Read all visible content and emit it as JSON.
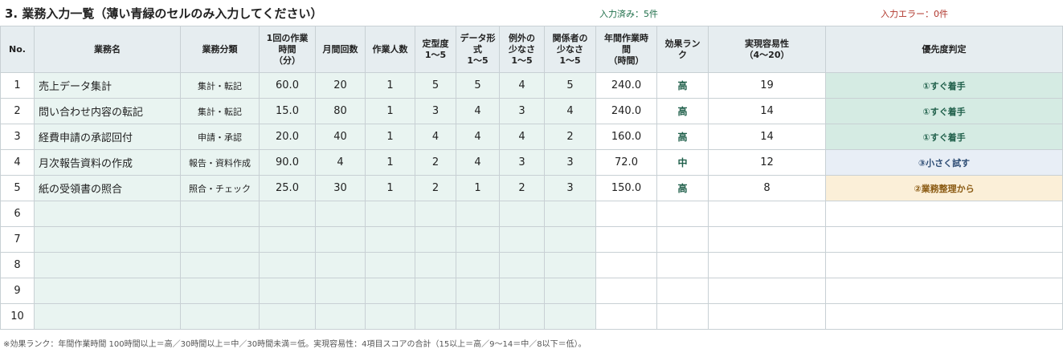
{
  "title": "3. 業務入力一覧（薄い青緑のセルのみ入力してください）",
  "status": {
    "ok": "入力済み：5件",
    "error": "入力エラー：0件"
  },
  "headers": [
    [
      "No."
    ],
    [
      "業務名"
    ],
    [
      "業務分類"
    ],
    [
      "1回の作業",
      "時間",
      "（分）"
    ],
    [
      "月間回数"
    ],
    [
      "作業人数"
    ],
    [
      "定型度",
      "1～5"
    ],
    [
      "データ形",
      "式",
      "1～5"
    ],
    [
      "例外の",
      "少なさ",
      "1～5"
    ],
    [
      "関係者の",
      "少なさ",
      "1～5"
    ],
    [
      "年間作業時",
      "間",
      "（時間）"
    ],
    [
      "効果ラン",
      "ク"
    ],
    [
      "実現容易性",
      "（4～20）"
    ],
    [
      "優先度判定"
    ]
  ],
  "rows": [
    {
      "no": "1",
      "name": "売上データ集計",
      "category": "集計・転記",
      "minutes": "60.0",
      "monthly": "20",
      "people": "1",
      "routine": "5",
      "data_format": "5",
      "exceptions": "4",
      "stakeholders": "5",
      "annual_hours": "240.0",
      "rank": "高",
      "feasibility": "19",
      "priority": "①すぐ着手",
      "priority_color": "green"
    },
    {
      "no": "2",
      "name": "問い合わせ内容の転記",
      "category": "集計・転記",
      "minutes": "15.0",
      "monthly": "80",
      "people": "1",
      "routine": "3",
      "data_format": "4",
      "exceptions": "3",
      "stakeholders": "4",
      "annual_hours": "240.0",
      "rank": "高",
      "feasibility": "14",
      "priority": "①すぐ着手",
      "priority_color": "green"
    },
    {
      "no": "3",
      "name": "経費申請の承認回付",
      "category": "申請・承認",
      "minutes": "20.0",
      "monthly": "40",
      "people": "1",
      "routine": "4",
      "data_format": "4",
      "exceptions": "4",
      "stakeholders": "2",
      "annual_hours": "160.0",
      "rank": "高",
      "feasibility": "14",
      "priority": "①すぐ着手",
      "priority_color": "green"
    },
    {
      "no": "4",
      "name": "月次報告資料の作成",
      "category": "報告・資料作成",
      "minutes": "90.0",
      "monthly": "4",
      "people": "1",
      "routine": "2",
      "data_format": "4",
      "exceptions": "3",
      "stakeholders": "3",
      "annual_hours": "72.0",
      "rank": "中",
      "feasibility": "12",
      "priority": "③小さく試す",
      "priority_color": "blue"
    },
    {
      "no": "5",
      "name": "紙の受領書の照合",
      "category": "照合・チェック",
      "minutes": "25.0",
      "monthly": "30",
      "people": "1",
      "routine": "2",
      "data_format": "1",
      "exceptions": "2",
      "stakeholders": "3",
      "annual_hours": "150.0",
      "rank": "高",
      "feasibility": "8",
      "priority": "②業務整理から",
      "priority_color": "orange"
    },
    {
      "no": "6",
      "name": "",
      "category": "",
      "minutes": "",
      "monthly": "",
      "people": "",
      "routine": "",
      "data_format": "",
      "exceptions": "",
      "stakeholders": "",
      "annual_hours": "",
      "rank": "",
      "feasibility": "",
      "priority": "",
      "priority_color": ""
    },
    {
      "no": "7",
      "name": "",
      "category": "",
      "minutes": "",
      "monthly": "",
      "people": "",
      "routine": "",
      "data_format": "",
      "exceptions": "",
      "stakeholders": "",
      "annual_hours": "",
      "rank": "",
      "feasibility": "",
      "priority": "",
      "priority_color": ""
    },
    {
      "no": "8",
      "name": "",
      "category": "",
      "minutes": "",
      "monthly": "",
      "people": "",
      "routine": "",
      "data_format": "",
      "exceptions": "",
      "stakeholders": "",
      "annual_hours": "",
      "rank": "",
      "feasibility": "",
      "priority": "",
      "priority_color": ""
    },
    {
      "no": "9",
      "name": "",
      "category": "",
      "minutes": "",
      "monthly": "",
      "people": "",
      "routine": "",
      "data_format": "",
      "exceptions": "",
      "stakeholders": "",
      "annual_hours": "",
      "rank": "",
      "feasibility": "",
      "priority": "",
      "priority_color": ""
    },
    {
      "no": "10",
      "name": "",
      "category": "",
      "minutes": "",
      "monthly": "",
      "people": "",
      "routine": "",
      "data_format": "",
      "exceptions": "",
      "stakeholders": "",
      "annual_hours": "",
      "rank": "",
      "feasibility": "",
      "priority": "",
      "priority_color": ""
    }
  ],
  "footnote": "※効果ランク：年間作業時間 100時間以上＝高／30時間以上＝中／30時間未満＝低。実現容易性：4項目スコアの合計（15以上＝高／9～14＝中／8以下＝低）。",
  "colors": {
    "input_cell": "#e9f4f1",
    "header": "#e6edf0",
    "priority_green": "#d5ebe3",
    "priority_blue": "#e8eef6",
    "priority_orange": "#fbefd8",
    "status_ok": "#1f6f4a",
    "status_error": "#b0352b"
  }
}
